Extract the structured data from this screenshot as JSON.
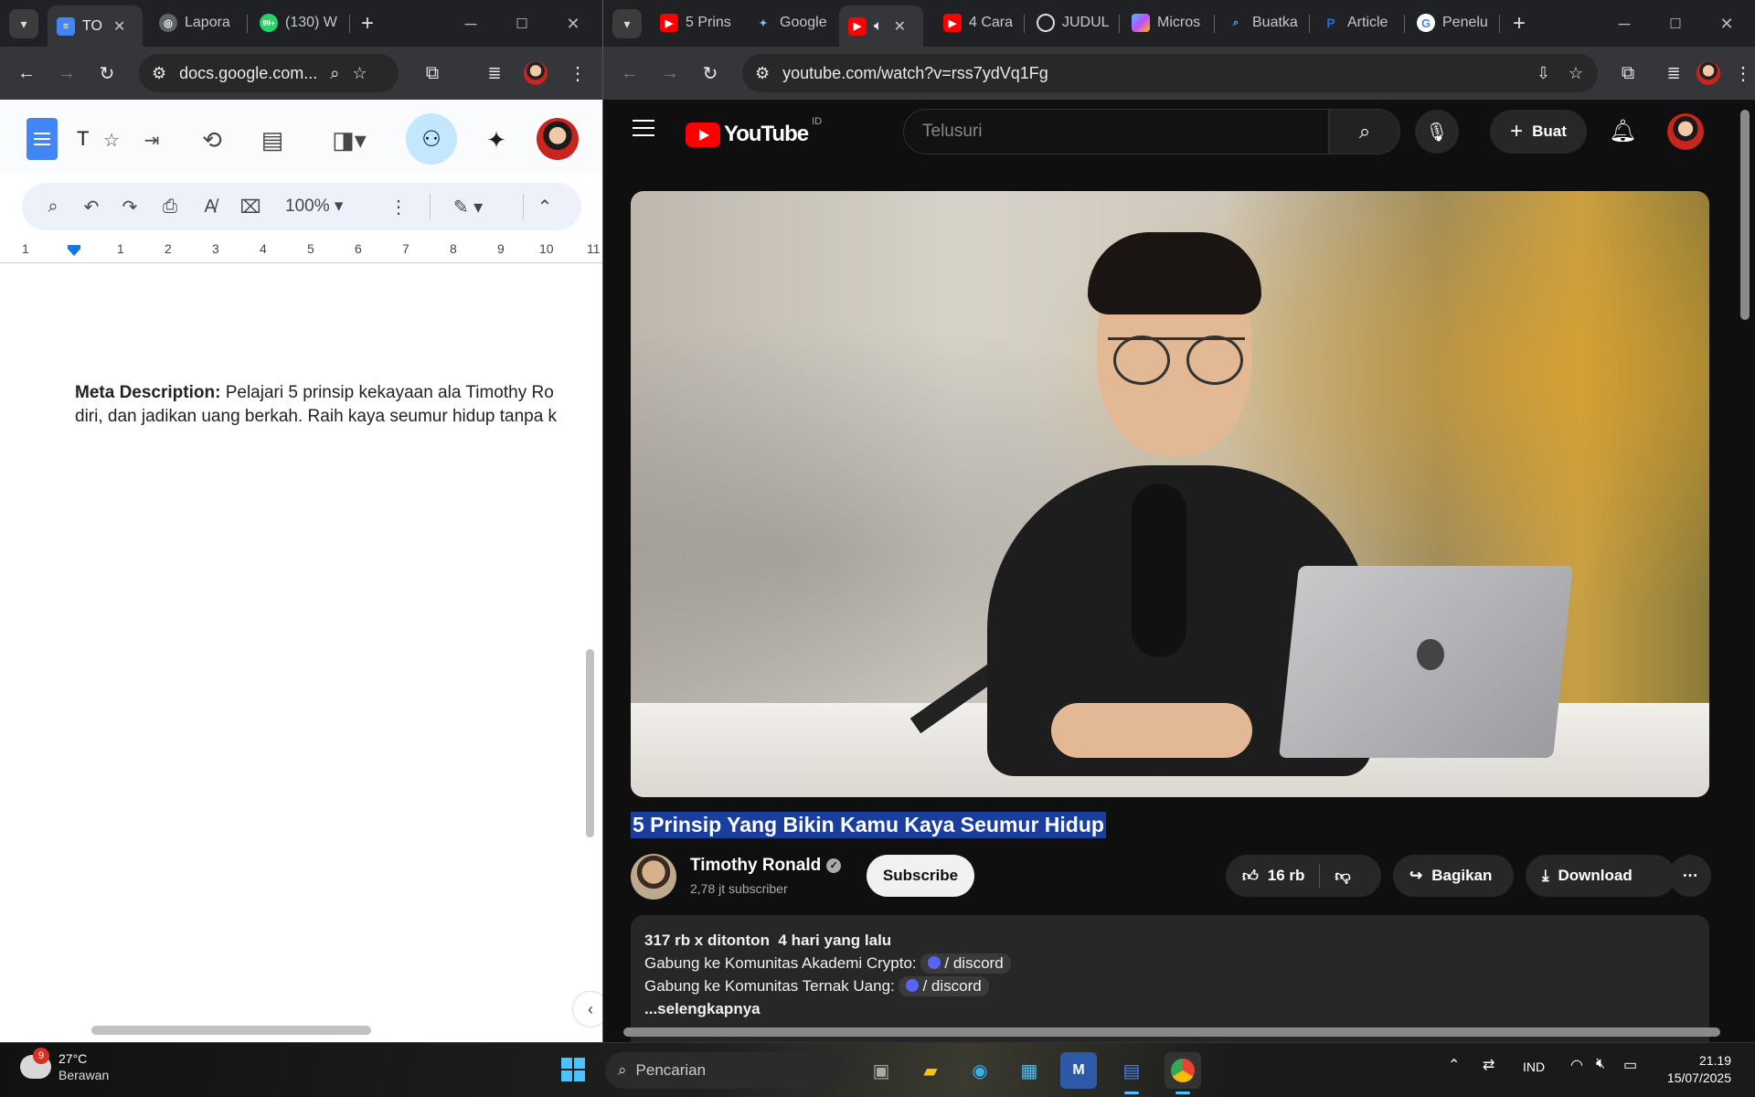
{
  "left_window": {
    "tabs": [
      {
        "label": "TO",
        "icon": "docs-icon",
        "active": true
      },
      {
        "label": "Lapora",
        "icon": "globe-icon"
      },
      {
        "label": "(130) W",
        "icon": "whatsapp-icon",
        "badge": "99+"
      }
    ],
    "url": "docs.google.com...",
    "doc_title_initial": "T",
    "zoom": "100%",
    "ruler_numbers": [
      "1",
      "1",
      "2",
      "3",
      "4",
      "5",
      "6",
      "7",
      "8",
      "9",
      "10",
      "11"
    ],
    "content": {
      "label": "Meta Description:",
      "line1": " Pelajari 5 prinsip kekayaan ala Timothy Ro",
      "line2": "diri, dan jadikan uang berkah. Raih kaya seumur hidup tanpa k"
    }
  },
  "right_window": {
    "tabs": [
      {
        "label": "5 Prins",
        "icon": "youtube-icon"
      },
      {
        "label": "Google",
        "icon": "gemini-icon"
      },
      {
        "label": "",
        "icon": "youtube-icon",
        "active": true,
        "audio": true
      },
      {
        "label": "4 Cara",
        "icon": "youtube-icon"
      },
      {
        "label": "JUDUL",
        "icon": "openai-icon"
      },
      {
        "label": "Micros",
        "icon": "copilot-icon"
      },
      {
        "label": "Buatka",
        "icon": "search-icon"
      },
      {
        "label": "Article",
        "icon": "p-icon"
      },
      {
        "label": "Penelu",
        "icon": "google-icon"
      }
    ],
    "url": "youtube.com/watch?v=rss7ydVq1Fg",
    "youtube": {
      "logo_text": "YouTube",
      "country": "ID",
      "search_placeholder": "Telusuri",
      "create_label": "Buat",
      "video_title": "5 Prinsip Yang Bikin Kamu Kaya Seumur Hidup",
      "channel_name": "Timothy Ronald",
      "subscribers": "2,78 jt subscriber",
      "subscribe_label": "Subscribe",
      "likes": "16 rb",
      "share_label": "Bagikan",
      "download_label": "Download",
      "views": "317 rb x ditonton",
      "age": "4 hari yang lalu",
      "desc_line1": "Gabung ke Komunitas Akademi Crypto:",
      "desc_link1": "/ discord",
      "desc_line2": "Gabung ke Komunitas Ternak Uang:",
      "desc_link2": "/ discord",
      "more_label": "...selengkapnya"
    }
  },
  "taskbar": {
    "weather_temp": "27°C",
    "weather_cond": "Berawan",
    "weather_badge": "9",
    "search_placeholder": "Pencarian",
    "lang": "IND",
    "time": "21.19",
    "date": "15/07/2025"
  }
}
